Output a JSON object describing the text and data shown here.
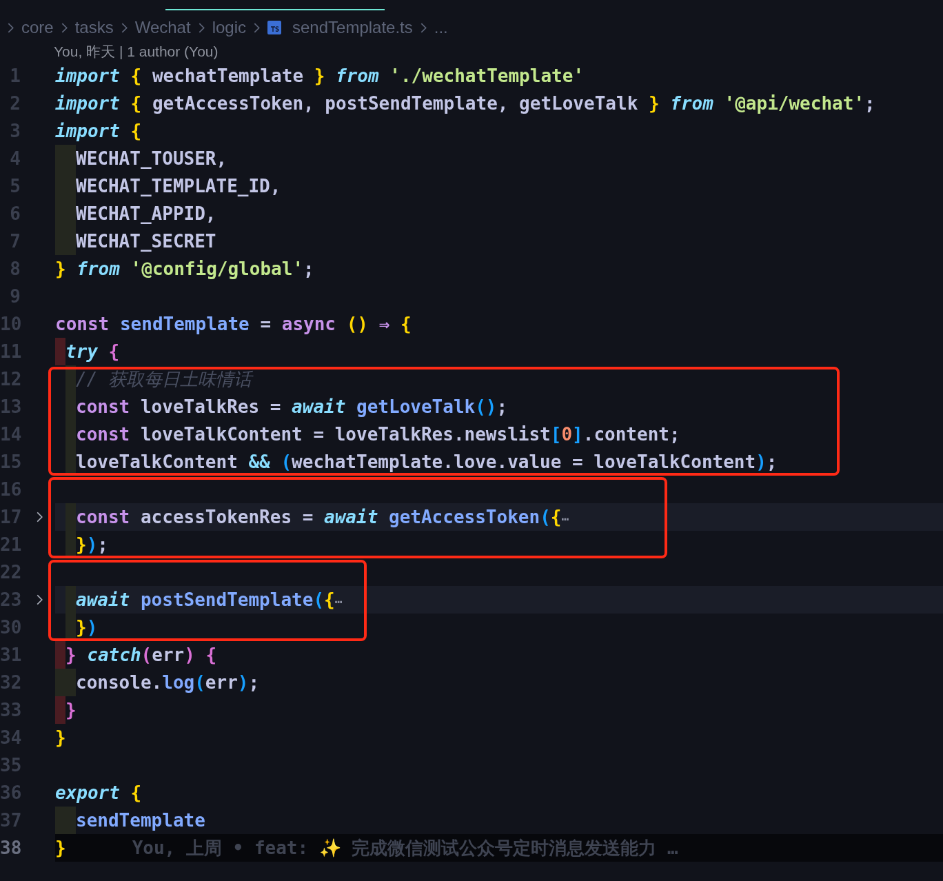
{
  "breadcrumb": {
    "items": [
      {
        "kind": "folder",
        "label": "core"
      },
      {
        "kind": "folder",
        "label": "tasks"
      },
      {
        "kind": "folder",
        "label": "Wechat"
      },
      {
        "kind": "folder",
        "label": "logic"
      },
      {
        "kind": "file",
        "label": "sendTemplate.ts"
      },
      {
        "kind": "more",
        "label": "..."
      }
    ]
  },
  "blame_header": "You, 昨天 | 1 author (You)",
  "code": [
    {
      "boxed": false,
      "lines": [
        {
          "number": "1",
          "folded": false,
          "highlighted": false,
          "current": false,
          "tokens": [
            {
              "kind": "kw",
              "text": "import"
            },
            {
              "kind": "b1",
              "text": " {"
            },
            {
              "kind": "id",
              "text": " wechatTemplate "
            },
            {
              "kind": "b1",
              "text": "} "
            },
            {
              "kind": "kw",
              "text": "from"
            },
            {
              "kind": "str",
              "text": " './wechatTemplate'"
            }
          ]
        },
        {
          "number": "2",
          "folded": false,
          "highlighted": false,
          "current": false,
          "tokens": [
            {
              "kind": "kw",
              "text": "import"
            },
            {
              "kind": "b1",
              "text": " {"
            },
            {
              "kind": "id",
              "text": " getAccessToken, postSendTemplate, getLoveTalk "
            },
            {
              "kind": "b1",
              "text": "} "
            },
            {
              "kind": "kw",
              "text": "from"
            },
            {
              "kind": "str",
              "text": " '@api/wechat'"
            },
            {
              "kind": "p",
              "text": ";"
            }
          ]
        },
        {
          "number": "3",
          "folded": false,
          "highlighted": false,
          "current": false,
          "tokens": [
            {
              "kind": "kw",
              "text": "import"
            },
            {
              "kind": "b1",
              "text": " {"
            }
          ]
        },
        {
          "number": "4",
          "folded": false,
          "highlighted": false,
          "current": false,
          "guides": [
            {
              "kind": "bar",
              "color": "#24271f"
            },
            {
              "kind": "bar",
              "color": "#24271f"
            }
          ],
          "tokens": [
            {
              "kind": "id",
              "text": "WECHAT_TOUSER"
            },
            {
              "kind": "p",
              "text": ","
            }
          ]
        },
        {
          "number": "5",
          "folded": false,
          "highlighted": false,
          "current": false,
          "guides": [
            {
              "kind": "bar",
              "color": "#24271f"
            },
            {
              "kind": "bar",
              "color": "#24271f"
            }
          ],
          "tokens": [
            {
              "kind": "id",
              "text": "WECHAT_TEMPLATE_ID"
            },
            {
              "kind": "p",
              "text": ","
            }
          ]
        },
        {
          "number": "6",
          "folded": false,
          "highlighted": false,
          "current": false,
          "guides": [
            {
              "kind": "bar",
              "color": "#24271f"
            },
            {
              "kind": "bar",
              "color": "#24271f"
            }
          ],
          "tokens": [
            {
              "kind": "id",
              "text": "WECHAT_APPID"
            },
            {
              "kind": "p",
              "text": ","
            }
          ]
        },
        {
          "number": "7",
          "folded": false,
          "highlighted": false,
          "current": false,
          "guides": [
            {
              "kind": "bar",
              "color": "#24271f"
            },
            {
              "kind": "bar",
              "color": "#24271f"
            }
          ],
          "tokens": [
            {
              "kind": "id",
              "text": "WECHAT_SECRET"
            }
          ]
        },
        {
          "number": "8",
          "folded": false,
          "highlighted": false,
          "current": false,
          "tokens": [
            {
              "kind": "b1",
              "text": "} "
            },
            {
              "kind": "kw",
              "text": "from"
            },
            {
              "kind": "str",
              "text": " '@config/global'"
            },
            {
              "kind": "p",
              "text": ";"
            }
          ]
        },
        {
          "number": "9",
          "folded": false,
          "highlighted": false,
          "current": false
        },
        {
          "number": "10",
          "folded": false,
          "highlighted": false,
          "current": false,
          "tokens": [
            {
              "kind": "st",
              "text": "const"
            },
            {
              "kind": "fn",
              "text": " sendTemplate"
            },
            {
              "kind": "p",
              "text": " = "
            },
            {
              "kind": "st",
              "text": "async"
            },
            {
              "kind": "b1",
              "text": " () "
            },
            {
              "kind": "st",
              "text": "⇒"
            },
            {
              "kind": "b1",
              "text": " {"
            }
          ]
        },
        {
          "number": "11",
          "folded": false,
          "highlighted": false,
          "current": false,
          "guides": [
            {
              "kind": "bar",
              "color": "#4a1c22"
            }
          ],
          "tokens": [
            {
              "kind": "kw",
              "text": "try"
            },
            {
              "kind": "b2",
              "text": " {"
            }
          ]
        }
      ]
    },
    {
      "boxed": true,
      "lines": [
        {
          "number": "12",
          "folded": false,
          "highlighted": false,
          "current": false,
          "guides": [
            {
              "kind": "blank"
            },
            {
              "kind": "bar",
              "color": "#24271f"
            }
          ],
          "tokens": [
            {
              "kind": "cm",
              "text": "// 获取每日土味情话"
            }
          ]
        },
        {
          "number": "13",
          "folded": false,
          "highlighted": false,
          "current": false,
          "guides": [
            {
              "kind": "blank"
            },
            {
              "kind": "bar",
              "color": "#24271f"
            }
          ],
          "tokens": [
            {
              "kind": "st",
              "text": "const"
            },
            {
              "kind": "id",
              "text": " loveTalkRes = "
            },
            {
              "kind": "kw",
              "text": "await"
            },
            {
              "kind": "fn",
              "text": " getLoveTalk"
            },
            {
              "kind": "b3",
              "text": "()"
            },
            {
              "kind": "p",
              "text": ";"
            }
          ]
        },
        {
          "number": "14",
          "folded": false,
          "highlighted": false,
          "current": false,
          "guides": [
            {
              "kind": "blank"
            },
            {
              "kind": "bar",
              "color": "#24271f"
            }
          ],
          "tokens": [
            {
              "kind": "st",
              "text": "const"
            },
            {
              "kind": "id",
              "text": " loveTalkContent = loveTalkRes.newslist"
            },
            {
              "kind": "b3",
              "text": "["
            },
            {
              "kind": "num",
              "text": "0"
            },
            {
              "kind": "b3",
              "text": "]"
            },
            {
              "kind": "id",
              "text": ".content"
            },
            {
              "kind": "p",
              "text": ";"
            }
          ]
        },
        {
          "number": "15",
          "folded": false,
          "highlighted": false,
          "current": false,
          "guides": [
            {
              "kind": "blank"
            },
            {
              "kind": "bar",
              "color": "#24271f"
            }
          ],
          "tokens": [
            {
              "kind": "id",
              "text": "loveTalkContent "
            },
            {
              "kind": "op",
              "text": "&&"
            },
            {
              "kind": "b3",
              "text": " ("
            },
            {
              "kind": "id",
              "text": "wechatTemplate.love.value = loveTalkContent"
            },
            {
              "kind": "b3",
              "text": ")"
            },
            {
              "kind": "p",
              "text": ";"
            }
          ]
        }
      ]
    },
    {
      "boxed": true,
      "lines": [
        {
          "number": "16",
          "folded": false,
          "highlighted": false,
          "current": false
        },
        {
          "number": "17",
          "folded": true,
          "highlighted": true,
          "current": false,
          "guides": [
            {
              "kind": "blank"
            },
            {
              "kind": "bar",
              "color": "#24271f"
            }
          ],
          "tokens": [
            {
              "kind": "st",
              "text": "const"
            },
            {
              "kind": "id",
              "text": " accessTokenRes = "
            },
            {
              "kind": "kw",
              "text": "await"
            },
            {
              "kind": "fn",
              "text": " getAccessToken"
            },
            {
              "kind": "b3",
              "text": "("
            },
            {
              "kind": "b1",
              "text": "{"
            },
            {
              "kind": "more",
              "text": "⋯"
            }
          ]
        },
        {
          "number": "21",
          "folded": false,
          "highlighted": false,
          "current": false,
          "guides": [
            {
              "kind": "blank"
            },
            {
              "kind": "bar",
              "color": "#24271f"
            }
          ],
          "tokens": [
            {
              "kind": "b1",
              "text": "}"
            },
            {
              "kind": "b3",
              "text": ")"
            },
            {
              "kind": "p",
              "text": ";"
            }
          ]
        }
      ]
    },
    {
      "boxed": true,
      "lines": [
        {
          "number": "22",
          "folded": false,
          "highlighted": false,
          "current": false
        },
        {
          "number": "23",
          "folded": true,
          "highlighted": true,
          "current": false,
          "guides": [
            {
              "kind": "blank"
            },
            {
              "kind": "bar",
              "color": "#24271f"
            }
          ],
          "tokens": [
            {
              "kind": "kw",
              "text": "await"
            },
            {
              "kind": "fn",
              "text": " postSendTemplate"
            },
            {
              "kind": "b3",
              "text": "("
            },
            {
              "kind": "b1",
              "text": "{"
            },
            {
              "kind": "more",
              "text": "⋯"
            }
          ]
        },
        {
          "number": "30",
          "folded": false,
          "highlighted": false,
          "current": false,
          "guides": [
            {
              "kind": "blank"
            },
            {
              "kind": "bar",
              "color": "#24271f"
            }
          ],
          "tokens": [
            {
              "kind": "b1",
              "text": "}"
            },
            {
              "kind": "b3",
              "text": ")"
            }
          ]
        }
      ]
    },
    {
      "boxed": false,
      "lines": [
        {
          "number": "31",
          "folded": false,
          "highlighted": false,
          "current": false,
          "guides": [
            {
              "kind": "bar",
              "color": "#4a1c22"
            }
          ],
          "tokens": [
            {
              "kind": "b2",
              "text": "} "
            },
            {
              "kind": "kw",
              "text": "catch"
            },
            {
              "kind": "b2",
              "text": "("
            },
            {
              "kind": "id",
              "text": "err"
            },
            {
              "kind": "b2",
              "text": ") {"
            }
          ]
        },
        {
          "number": "32",
          "folded": false,
          "highlighted": false,
          "current": false,
          "guides": [
            {
              "kind": "bar",
              "color": "#24271f"
            },
            {
              "kind": "bar",
              "color": "#24271f"
            }
          ],
          "tokens": [
            {
              "kind": "id",
              "text": "console."
            },
            {
              "kind": "fn",
              "text": "log"
            },
            {
              "kind": "b3",
              "text": "("
            },
            {
              "kind": "id",
              "text": "err"
            },
            {
              "kind": "b3",
              "text": ")"
            },
            {
              "kind": "p",
              "text": ";"
            }
          ]
        },
        {
          "number": "33",
          "folded": false,
          "highlighted": false,
          "current": false,
          "guides": [
            {
              "kind": "bar",
              "color": "#4a1c22"
            }
          ],
          "tokens": [
            {
              "kind": "b2",
              "text": "}"
            }
          ]
        },
        {
          "number": "34",
          "folded": false,
          "highlighted": false,
          "current": false,
          "tokens": [
            {
              "kind": "b1",
              "text": "}"
            }
          ]
        },
        {
          "number": "35",
          "folded": false,
          "highlighted": false,
          "current": false
        },
        {
          "number": "36",
          "folded": false,
          "highlighted": false,
          "current": false,
          "tokens": [
            {
              "kind": "kw",
              "text": "export"
            },
            {
              "kind": "b1",
              "text": " {"
            }
          ]
        },
        {
          "number": "37",
          "folded": false,
          "highlighted": false,
          "current": false,
          "guides": [
            {
              "kind": "bar",
              "color": "#24271f"
            },
            {
              "kind": "bar",
              "color": "#24271f"
            }
          ],
          "tokens": [
            {
              "kind": "fn",
              "text": "sendTemplate"
            }
          ]
        },
        {
          "number": "38",
          "folded": false,
          "highlighted": false,
          "current": true,
          "tokens": [
            {
              "kind": "b1",
              "text": "}"
            }
          ],
          "blame": "You, 上周 • feat: ✨ 完成微信测试公众号定时消息发送能力 …"
        }
      ]
    }
  ]
}
